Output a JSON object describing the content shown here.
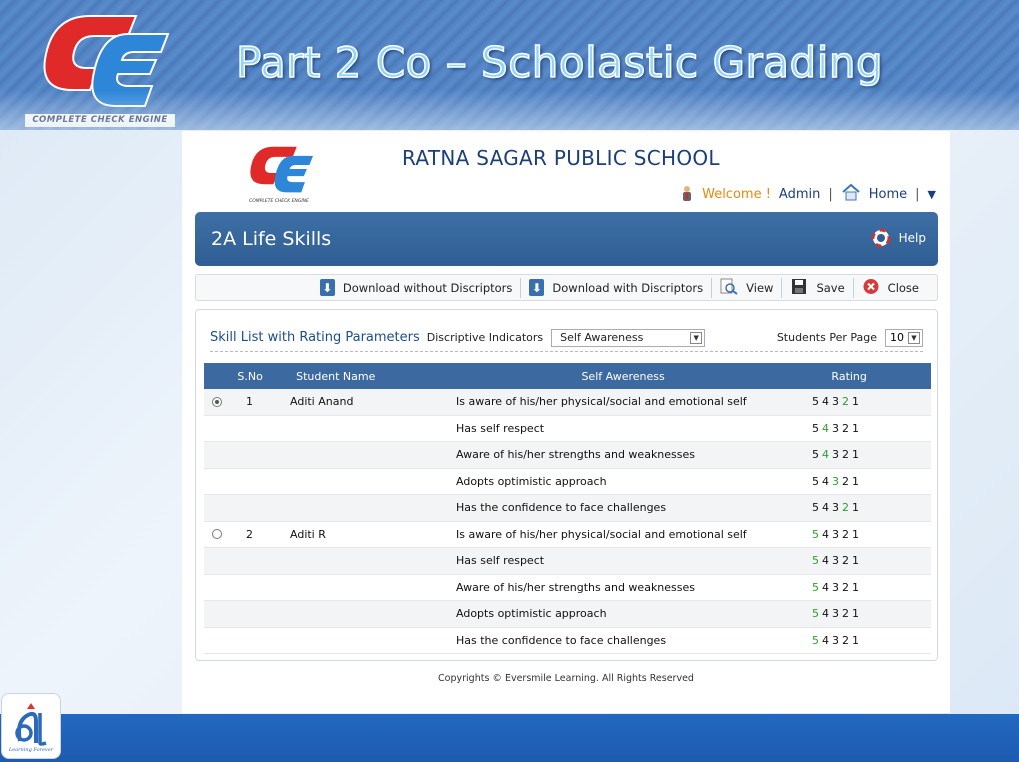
{
  "slide": {
    "title": "Part 2 Co – Scholastic Grading",
    "logo_caption": "COMPLETE CHECK ENGINE"
  },
  "app": {
    "school_name": "RATNA SAGAR PUBLIC SCHOOL",
    "logo_caption": "COMPLETE CHECK ENGINE",
    "welcome": "Welcome !",
    "admin": "Admin",
    "home": "Home",
    "page_title": "2A Life Skills",
    "help": "Help",
    "toolbar": {
      "download_without": "Download without Discriptors",
      "download_with": "Download with Discriptors",
      "view": "View",
      "save": "Save",
      "close": "Close"
    },
    "panel": {
      "title": "Skill List with Rating Parameters",
      "desc_label": "Discriptive Indicators",
      "desc_value": "Self Awareness",
      "spp_label": "Students Per Page",
      "spp_value": "10"
    },
    "columns": {
      "sno": "S.No",
      "name": "Student Name",
      "skill": "Self Awereness",
      "rating": "Rating"
    },
    "rows": [
      {
        "radio": true,
        "sno": "1",
        "name": "Aditi Anand",
        "skill": "Is aware of his/her physical/social and emotional self",
        "selected": 2
      },
      {
        "radio": null,
        "sno": "",
        "name": "",
        "skill": "Has self respect",
        "selected": 4
      },
      {
        "radio": null,
        "sno": "",
        "name": "",
        "skill": "Aware of his/her strengths and weaknesses",
        "selected": 4
      },
      {
        "radio": null,
        "sno": "",
        "name": "",
        "skill": "Adopts optimistic approach",
        "selected": 3
      },
      {
        "radio": null,
        "sno": "",
        "name": "",
        "skill": "Has the confidence to face challenges",
        "selected": 2
      },
      {
        "radio": false,
        "sno": "2",
        "name": "Aditi R",
        "skill": "Is aware of his/her physical/social and emotional self",
        "selected": 5
      },
      {
        "radio": null,
        "sno": "",
        "name": "",
        "skill": "Has self respect",
        "selected": 5
      },
      {
        "radio": null,
        "sno": "",
        "name": "",
        "skill": "Aware of his/her strengths and weaknesses",
        "selected": 5
      },
      {
        "radio": null,
        "sno": "",
        "name": "",
        "skill": "Adopts optimistic approach",
        "selected": 5
      },
      {
        "radio": null,
        "sno": "",
        "name": "",
        "skill": "Has the confidence to face challenges",
        "selected": 5
      }
    ],
    "rating_scale": [
      "5",
      "4",
      "3",
      "2",
      "1"
    ],
    "copyright": "Copyrights © Eversmile Learning. All Rights Reserved"
  },
  "colors": {
    "selected_rating": "#2aa12a",
    "header_blue": "#3c6aa0",
    "welcome": "#e38a10"
  },
  "icons": [
    "cce-logo",
    "person-icon",
    "home-icon",
    "help-lifebuoy-icon",
    "download-icon",
    "view-magnifier-icon",
    "save-disk-icon",
    "close-icon",
    "learning-logo"
  ]
}
